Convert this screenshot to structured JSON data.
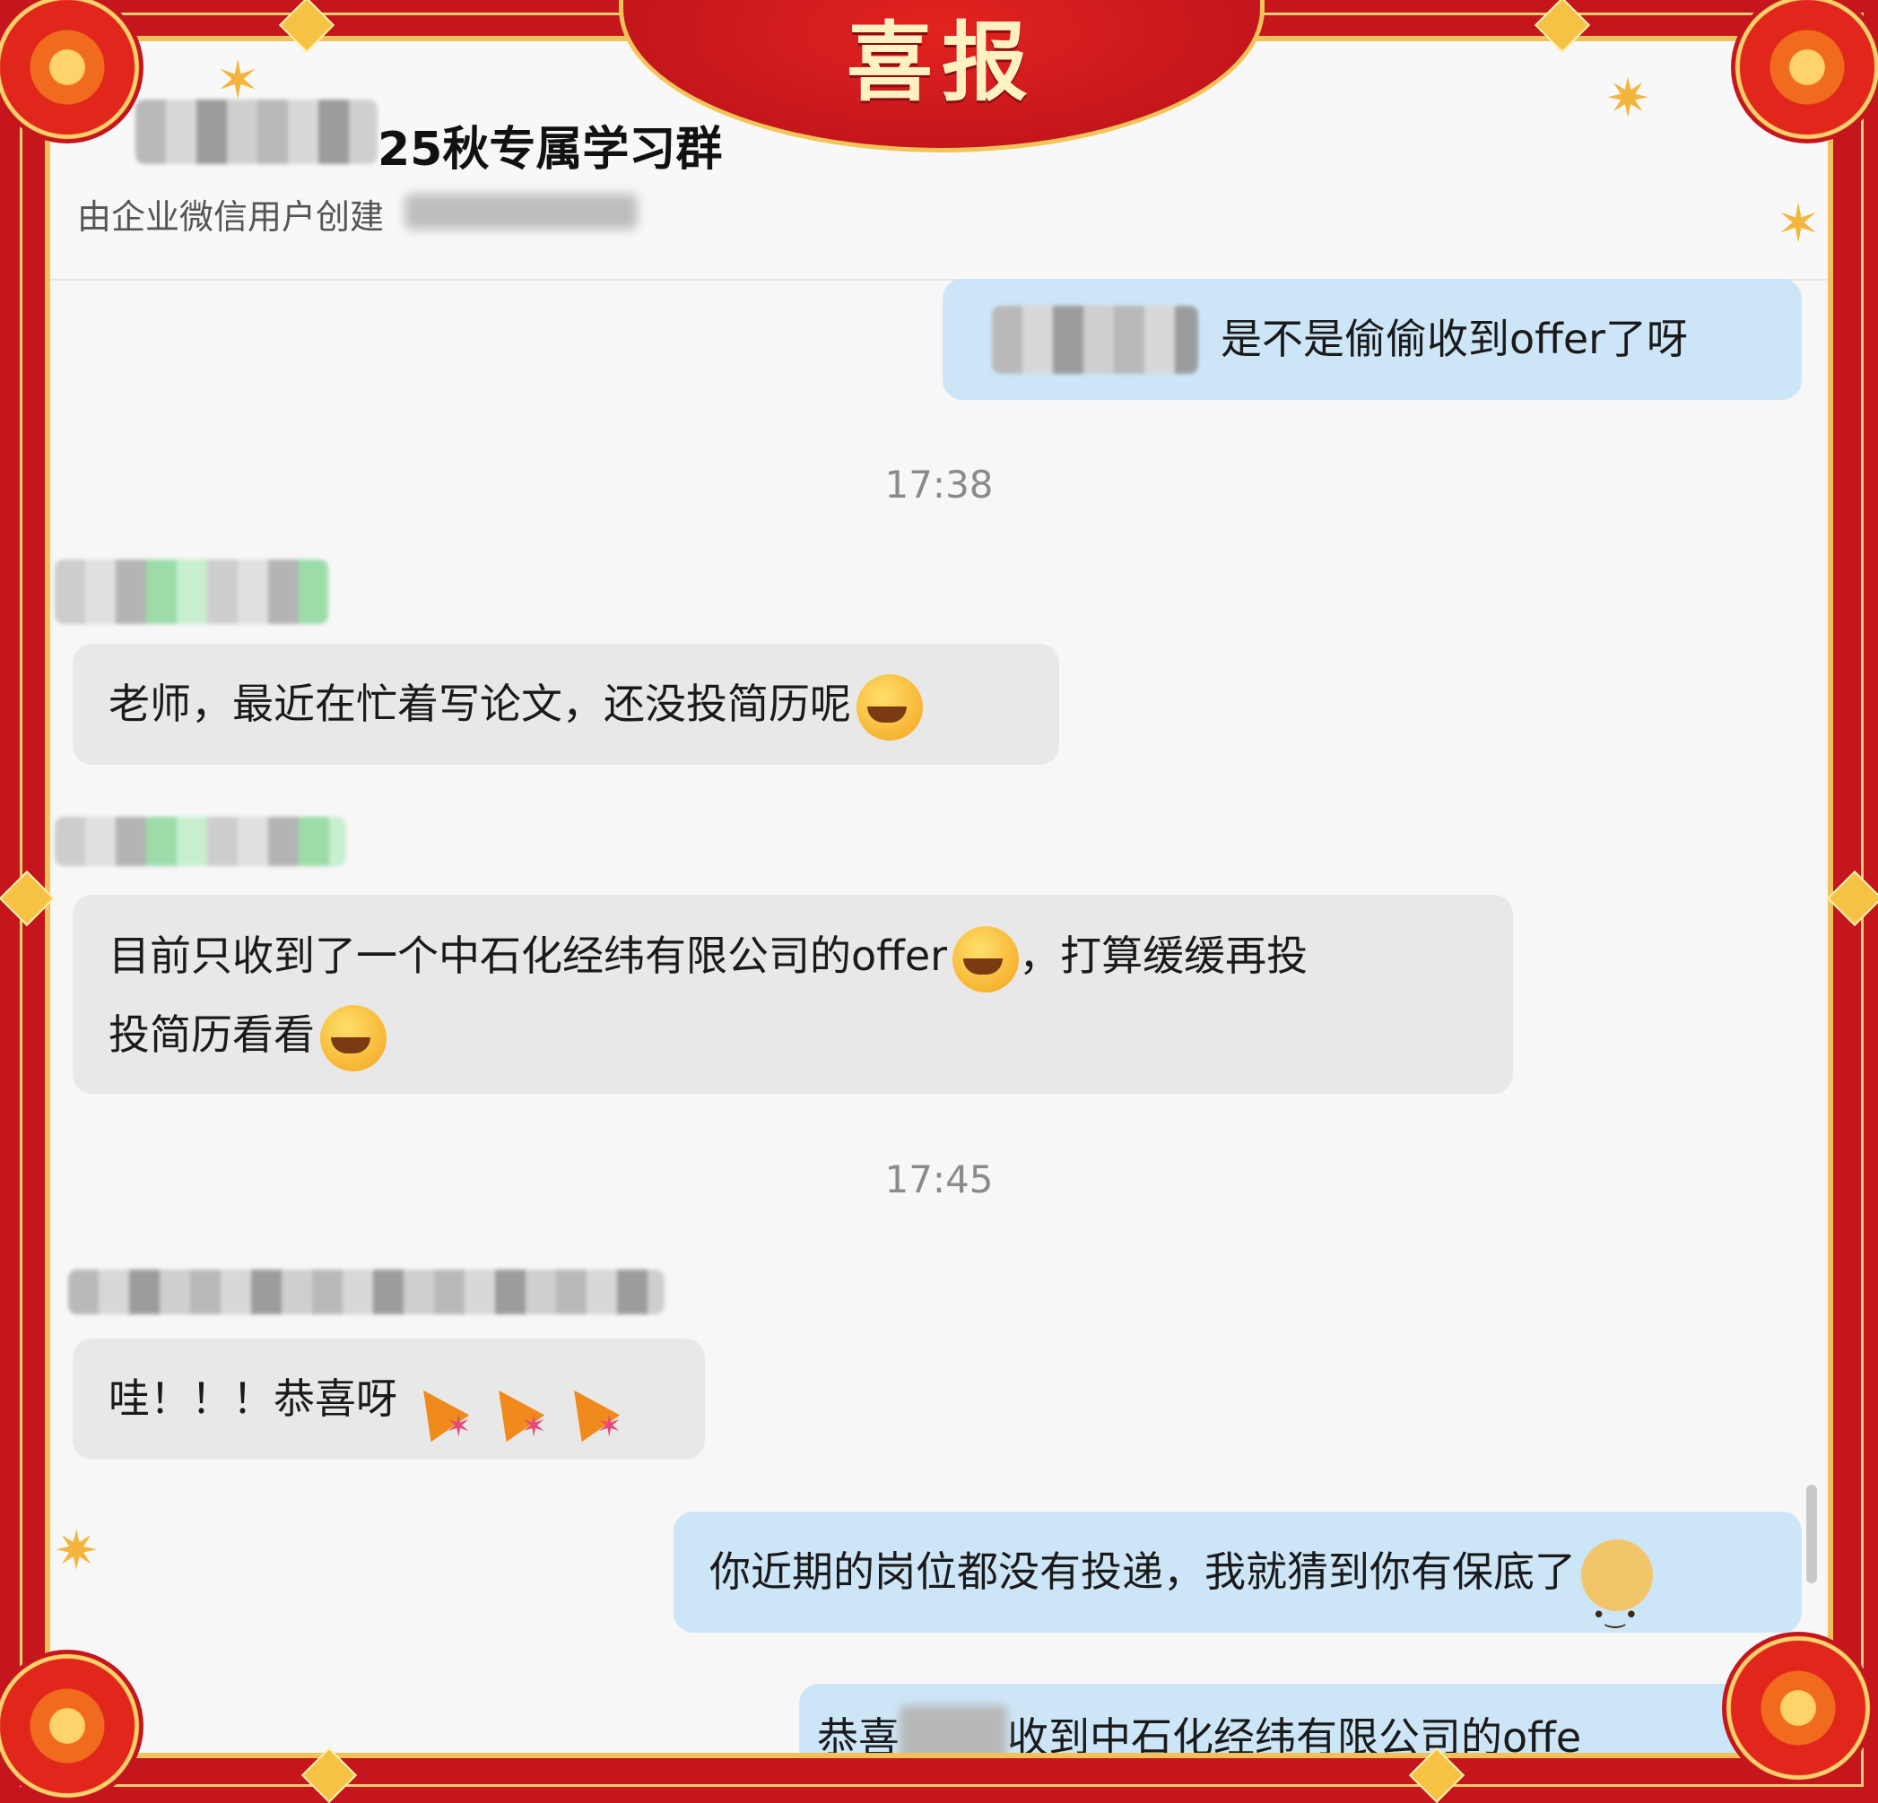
{
  "banner": {
    "title": "喜报"
  },
  "header": {
    "group_name": "25秋专属学习群",
    "group_sub": "由企业微信用户创建"
  },
  "messages": [
    {
      "side": "me",
      "text": "是不是偷偷收到offer了呀"
    },
    {
      "time": "17:38"
    },
    {
      "side": "other",
      "text": "老师，最近在忙着写论文，还没投简历呢",
      "emoji": "face-emoji-icon"
    },
    {
      "side": "other",
      "text_line1": "目前只收到了一个中石化经纬有限公司的offer",
      "text_line1b": "，打算缓缓再投",
      "text_line2": "投简历看看"
    },
    {
      "time": "17:45"
    },
    {
      "side": "other",
      "text": "哇！！！恭喜呀"
    },
    {
      "side": "me",
      "text": "你近期的岗位都没有投递，我就猜到你有保底了"
    },
    {
      "side": "me",
      "text_pre": "恭喜",
      "text_post": "收到中石化经纬有限公司的offe"
    }
  ],
  "colors": {
    "frame_red": "#c4161c",
    "gold": "#f3c45a",
    "my_bubble": "#cde6f7",
    "other_bubble": "#e8e8e8"
  }
}
